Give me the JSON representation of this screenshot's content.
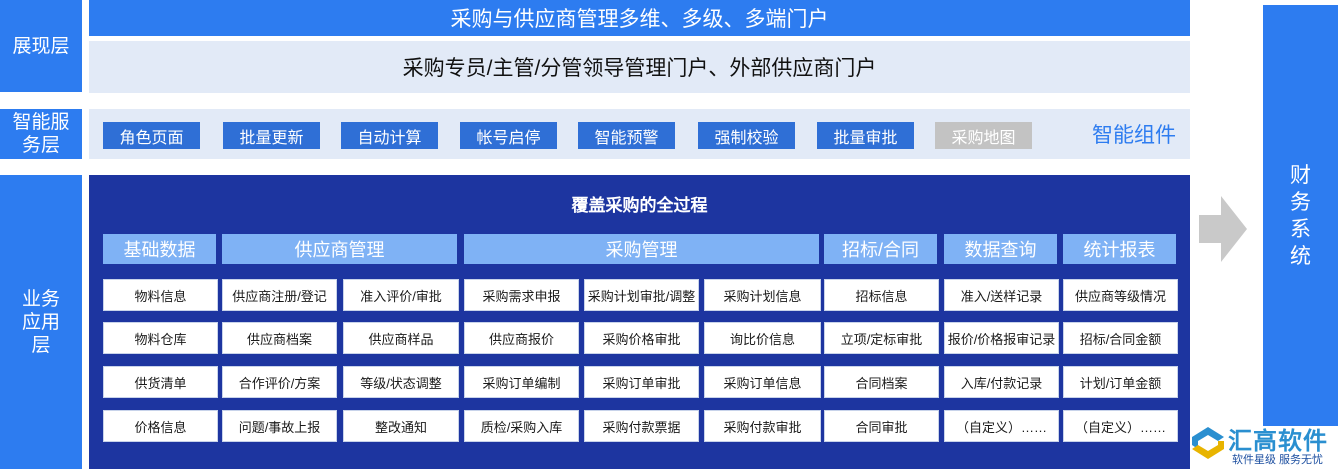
{
  "layers": {
    "display": "展现层",
    "service": "智能服务层",
    "business": "业务应用层"
  },
  "display": {
    "top_banner": "采购与供应商管理多维、多级、多端门户",
    "sub_banner": "采购专员/主管/分管领导管理门户、外部供应商门户"
  },
  "service": {
    "chips": [
      "角色页面",
      "批量更新",
      "自动计算",
      "帐号启停",
      "智能预警",
      "强制校验",
      "批量审批",
      "采购地图"
    ],
    "label": "智能组件"
  },
  "business": {
    "title": "覆盖采购的全过程",
    "categories": [
      "基础数据",
      "供应商管理",
      "采购管理",
      "招标/合同",
      "数据查询",
      "统计报表"
    ],
    "columns": [
      [
        "物料信息",
        "物料仓库",
        "供货清单",
        "价格信息"
      ],
      [
        "供应商注册/登记",
        "供应商档案",
        "合作评价/方案",
        "问题/事故上报"
      ],
      [
        "准入评价/审批",
        "供应商样品",
        "等级/状态调整",
        "整改通知"
      ],
      [
        "采购需求申报",
        "供应商报价",
        "采购订单编制",
        "质检/采购入库"
      ],
      [
        "采购计划审批/调整",
        "采购价格审批",
        "采购订单审批",
        "采购付款票据"
      ],
      [
        "采购计划信息",
        "询比价信息",
        "采购订单信息",
        "采购付款审批"
      ],
      [
        "招标信息",
        "立项/定标审批",
        "合同档案",
        "合同审批"
      ],
      [
        "准入/送样记录",
        "报价/价格报审记录",
        "入库/付款记录",
        "（自定义）……"
      ],
      [
        "供应商等级情况",
        "招标/合同金额",
        "计划/订单金额",
        "（自定义）……"
      ]
    ]
  },
  "finance": "财务系统",
  "logo": {
    "name": "汇高软件",
    "slogan": "软件星级 服务无忧"
  },
  "colors": {
    "primary": "#2d7cf0",
    "panel": "#1d35a0",
    "category": "#7fb2f5",
    "chip": "#2f6fd6",
    "light": "#e2eaf7"
  }
}
